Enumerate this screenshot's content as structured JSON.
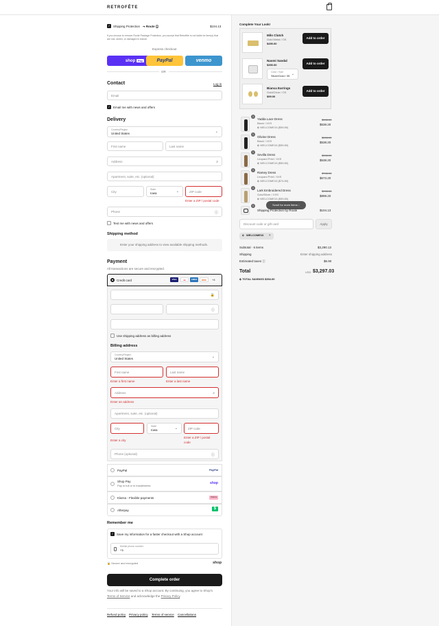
{
  "header": {
    "brand": "RETROFÊTE"
  },
  "protection": {
    "label": "Shipping Protection",
    "brand": "Route",
    "price": "$104.13",
    "note": "If you choose to remove Route Package Protection, you accept that Retrofête is not liable for item(s) that are lost, stolen, or damaged in transit."
  },
  "express": {
    "title": "Express checkout",
    "shop_pay": "shop",
    "shop_pay_badge": "Pay",
    "paypal": "PayPal",
    "venmo": "venmo",
    "or": "OR"
  },
  "contact": {
    "title": "Contact",
    "login": "Log in",
    "email_ph": "Email",
    "news": "Email me with news and offers"
  },
  "delivery": {
    "title": "Delivery",
    "country_label": "Country/Region",
    "country": "United States",
    "first_ph": "First name",
    "last_ph": "Last name",
    "address_ph": "Address",
    "apt_ph": "Apartment, suite, etc. (optional)",
    "city_ph": "City",
    "state_label": "State",
    "state": "Iowa",
    "zip_ph": "ZIP code",
    "zip_err": "Enter a ZIP / postal code",
    "phone_ph": "Phone",
    "text_news": "Text me with news and offers"
  },
  "shipping": {
    "title": "Shipping method",
    "note": "Enter your shipping address to view available shipping methods."
  },
  "payment": {
    "title": "Payment",
    "subtitle": "All transactions are secure and encrypted.",
    "credit": "Credit card",
    "more": "+4",
    "billing_same": "Use shipping address as billing address",
    "billing_title": "Billing address",
    "country_label": "Country/Region",
    "country": "United States",
    "first_ph": "First name",
    "last_ph": "Last name",
    "first_err": "Enter a first name",
    "last_err": "Enter a last name",
    "address_ph": "Address",
    "address_err": "Enter an address",
    "apt_ph": "Apartment, suite, etc. (optional)",
    "city_ph": "City",
    "state_label": "State",
    "state": "Iowa",
    "zip_ph": "ZIP code",
    "city_err": "Enter a city",
    "zip_err1": "Enter a ZIP / postal",
    "zip_err2": "code",
    "phone_ph": "Phone (optional)",
    "paypal": "PayPal",
    "paypal_logo": "PayPal",
    "shoppay": "Shop Pay",
    "shoppay_sub": "Pay in full or in installments",
    "shoppay_logo": "shop",
    "klarna": "Klarna - Flexible payments",
    "klarna_logo": "Klarna",
    "afterpay": "Afterpay",
    "afterpay_logo": "$"
  },
  "remember": {
    "title": "Remember me",
    "save": "Save my information for a faster checkout with a Shop account",
    "mobile_label": "Mobile phone number",
    "mobile_val": "+1",
    "secure": "Secure and encrypted",
    "shop": "shop"
  },
  "complete": {
    "button": "Complete order",
    "terms1": "Your info will be saved to a Shop account. By continuing, you agree to Shop's",
    "terms2a": "Terms of Service",
    "terms2b": " and acknowledge the ",
    "terms2c": "Privacy Policy",
    "terms2d": "."
  },
  "footer": {
    "links": [
      "Refund policy",
      "Privacy policy",
      "Terms of service",
      "Cancellations"
    ]
  },
  "upsell": {
    "title": "Complete Your Look!",
    "button": "Add to order",
    "items": [
      {
        "name": "Milo Clutch",
        "variant": "Gold Metal / OS",
        "price": "$490.00"
      },
      {
        "name": "Naomi Sandal",
        "price": "$390.00",
        "select_label": "Color / Size",
        "select_value": "Silver/Gold / 35"
      },
      {
        "name": "Bianca Earrings",
        "variant": "Gold/Clear / OS",
        "price": "$99.00"
      }
    ]
  },
  "cart": {
    "items": [
      {
        "qty": "1",
        "name": "Yadda Lace Dress",
        "variant": "Black / XXS",
        "discount": "WELCOME10 ($59.80)",
        "compare": "$598.00",
        "price": "$538.20"
      },
      {
        "qty": "1",
        "name": "Olivine Dress",
        "variant": "Black / XXS",
        "discount": "WELCOME10 ($59.80)",
        "compare": "$598.00",
        "price": "$538.20"
      },
      {
        "qty": "1",
        "name": "Sevilla Dress",
        "variant": "Leopard Print / XXS",
        "discount": "WELCOME10 ($59.80)",
        "compare": "$598.00",
        "price": "$538.20"
      },
      {
        "qty": "1",
        "name": "Ramey Dress",
        "variant": "Leopard Print / XXS",
        "discount": "WELCOME10 ($74.80)",
        "compare": "$748.00",
        "price": "$673.20"
      },
      {
        "qty": "1",
        "name": "Lark Embroidered Dress",
        "variant": "Gold/Silver / XXS",
        "discount": "WELCOME10 ($99.80)",
        "compare": "$998.00",
        "price": "$898.20"
      }
    ],
    "scroll_hint": "Scroll for more items ↓",
    "protection_name": "Shipping Protection by Route",
    "protection_price": "$104.13"
  },
  "discount": {
    "placeholder": "Discount code or gift card",
    "apply": "Apply",
    "code": "WELCOME10"
  },
  "summary": {
    "subtotal_label": "Subtotal · 6 items",
    "subtotal": "$3,290.13",
    "shipping_label": "Shipping",
    "shipping": "Enter shipping address",
    "taxes_label": "Estimated taxes",
    "taxes": "$6.90",
    "total_label": "Total",
    "currency": "USD",
    "total": "$3,297.03",
    "savings": "TOTAL SAVINGS $354.00"
  }
}
